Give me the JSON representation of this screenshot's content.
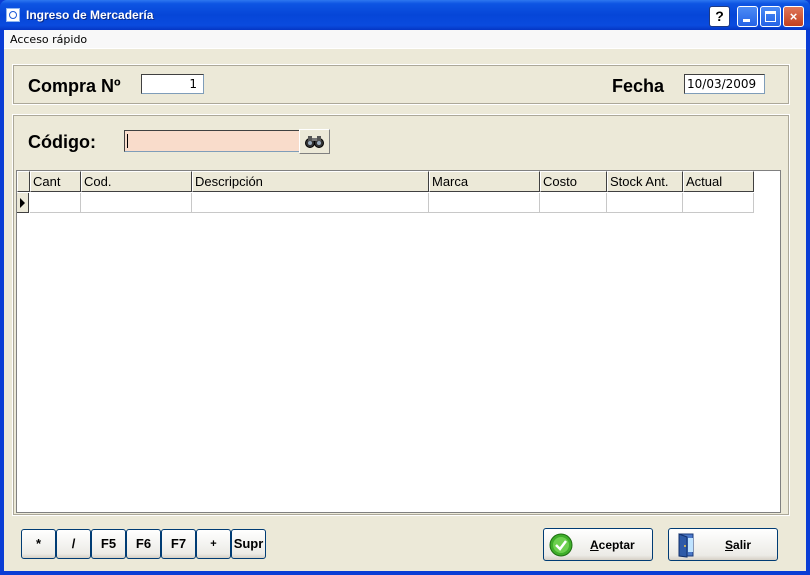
{
  "window": {
    "title": "Ingreso de Mercadería",
    "controls": {
      "help": "?",
      "minimize": "",
      "maximize": "",
      "close": "×"
    }
  },
  "menu": {
    "quick_access": "Acceso rápido"
  },
  "header": {
    "purchase_label": "Compra Nº",
    "purchase_number": "1",
    "date_label": "Fecha",
    "date_value": "10/03/2009"
  },
  "search": {
    "code_label": "Código:",
    "code_value": ""
  },
  "grid": {
    "columns": [
      "Cant",
      "Cod.",
      "Descripción",
      "Marca",
      "Costo",
      "Stock Ant.",
      "Actual"
    ],
    "rows": [
      [
        "",
        "",
        "",
        "",
        "",
        "",
        ""
      ]
    ]
  },
  "keys": [
    "*",
    "/",
    "F5",
    "F6",
    "F7",
    "+",
    "Supr"
  ],
  "actions": {
    "accept_first": "A",
    "accept_rest": "ceptar",
    "exit_first": "S",
    "exit_rest": "alir"
  },
  "colors": {
    "code_field_bg": "#F9DCCB",
    "title_bar": "#0A4BDE",
    "form_bg": "#ECE9D8"
  }
}
